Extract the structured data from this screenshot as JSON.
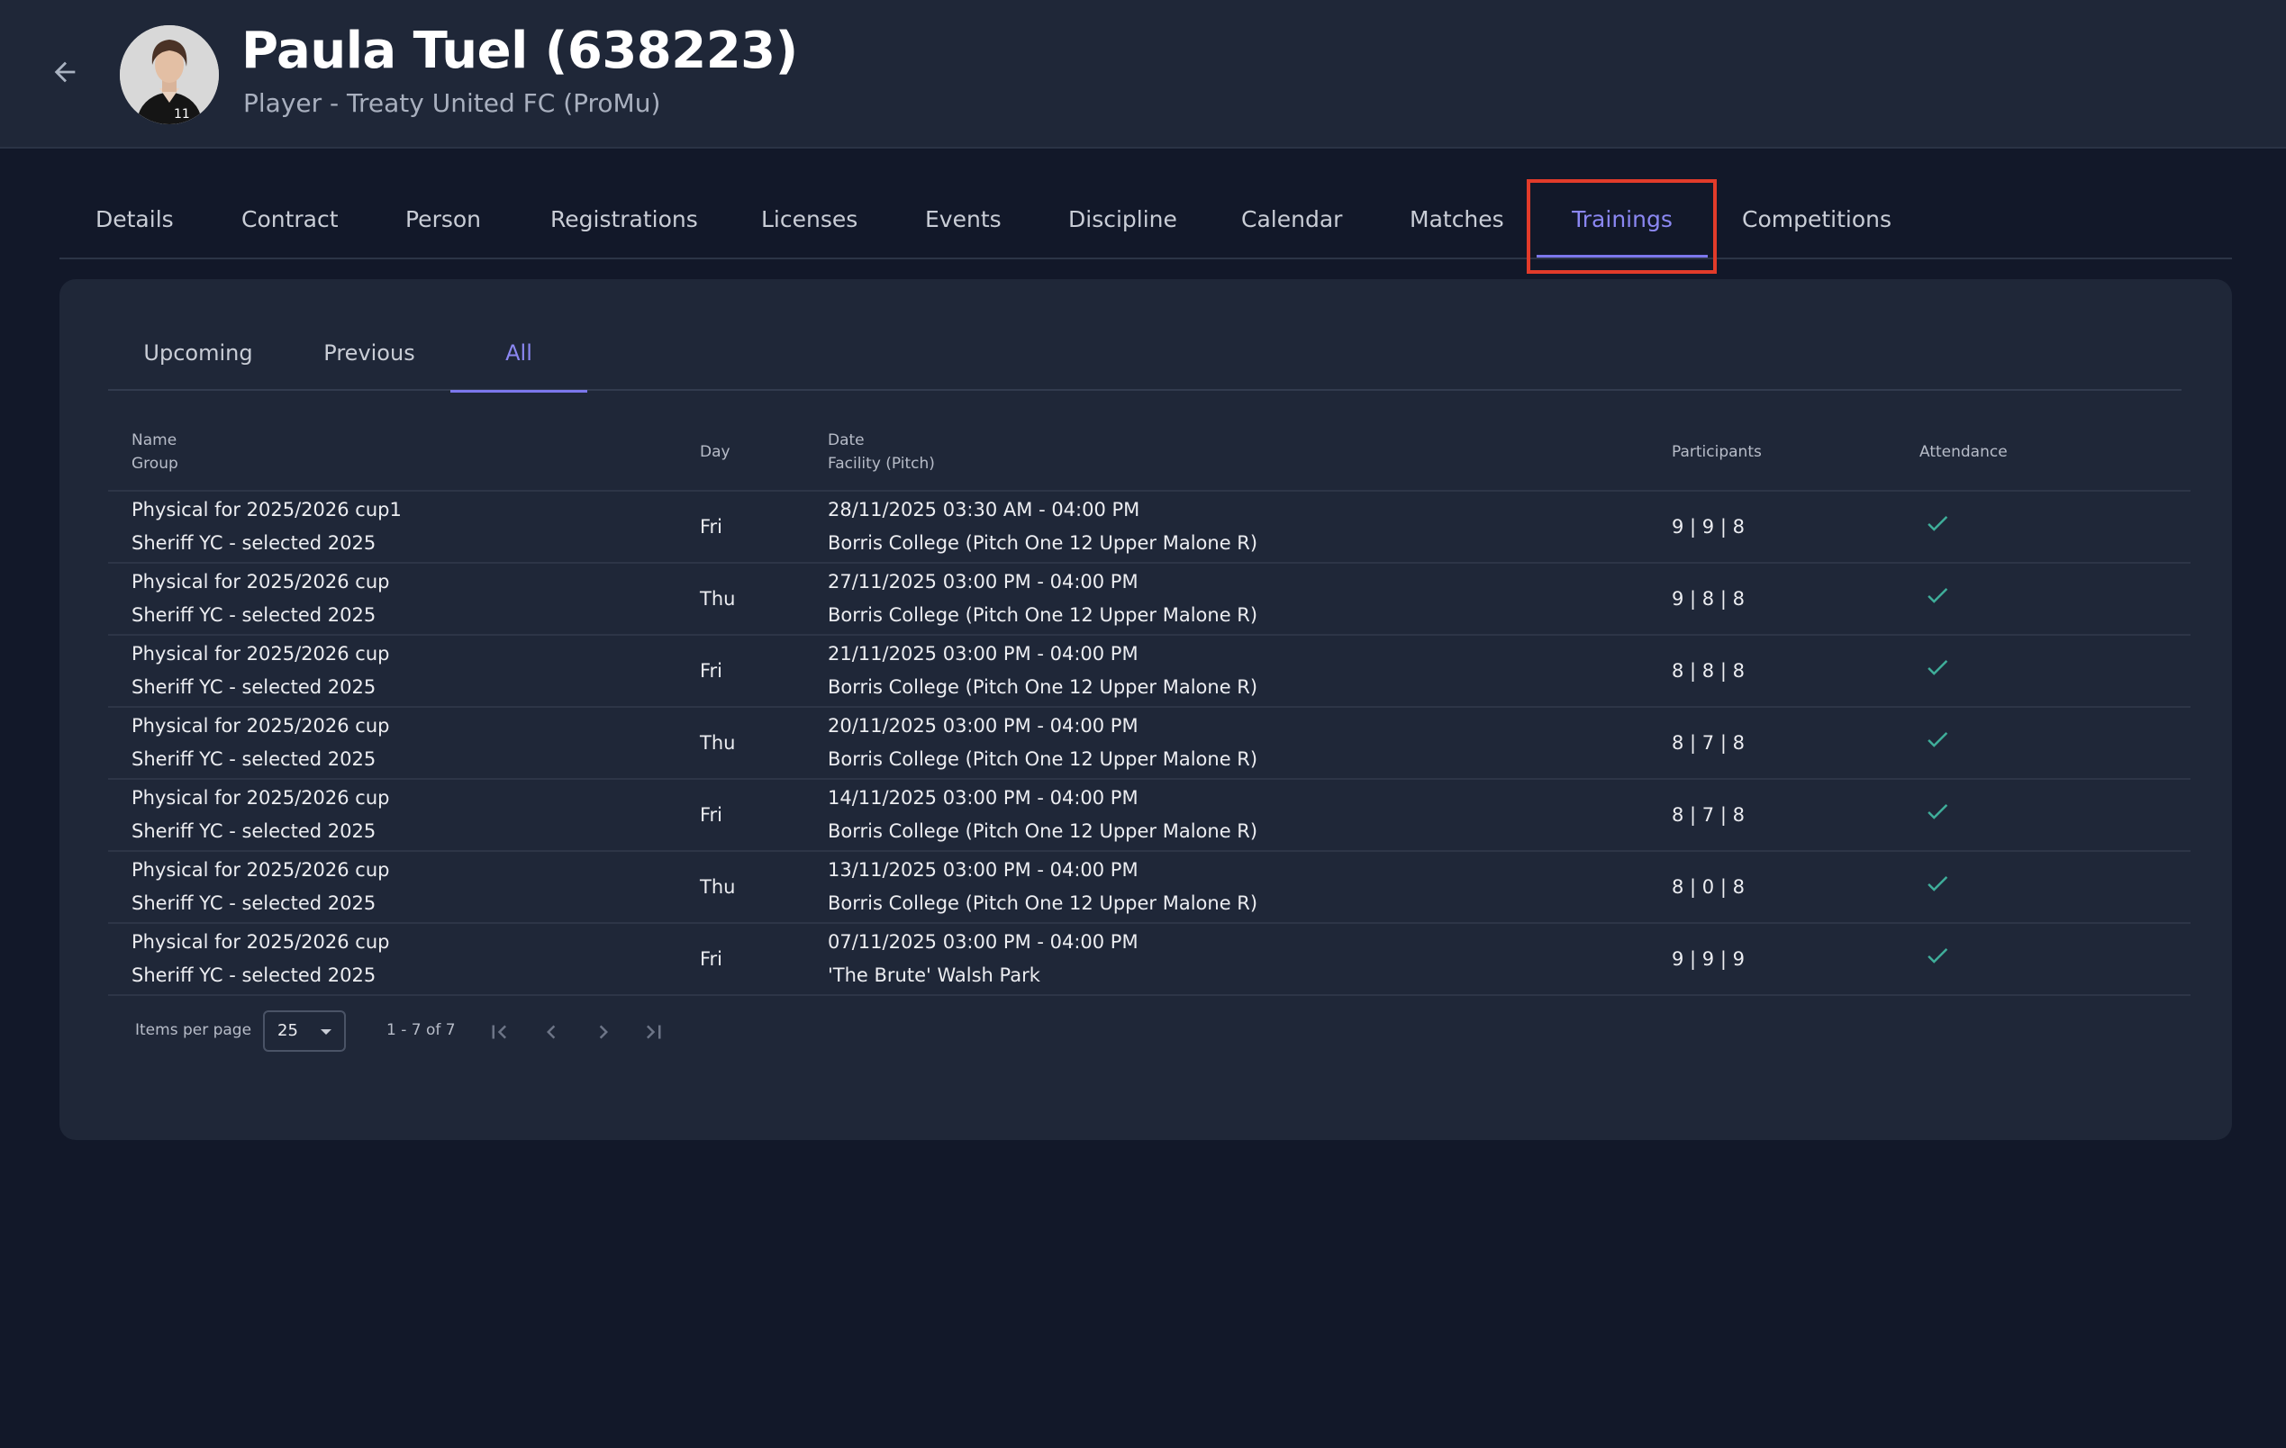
{
  "header": {
    "title": "Paula Tuel (638223)",
    "subtitle": "Player - Treaty United FC (ProMu)",
    "back_icon": "arrow-left-icon",
    "avatar_icon": "player-avatar"
  },
  "main_tabs": [
    {
      "label": "Details"
    },
    {
      "label": "Contract"
    },
    {
      "label": "Person"
    },
    {
      "label": "Registrations"
    },
    {
      "label": "Licenses"
    },
    {
      "label": "Events"
    },
    {
      "label": "Discipline"
    },
    {
      "label": "Calendar"
    },
    {
      "label": "Matches"
    },
    {
      "label": "Trainings",
      "active": true
    },
    {
      "label": "Competitions"
    }
  ],
  "sub_tabs": [
    {
      "label": "Upcoming"
    },
    {
      "label": "Previous"
    },
    {
      "label": "All",
      "active": true
    }
  ],
  "table": {
    "headers": {
      "name": "Name",
      "group": "Group",
      "day": "Day",
      "date": "Date",
      "facility": "Facility (Pitch)",
      "participants": "Participants",
      "attendance": "Attendance"
    },
    "rows": [
      {
        "name": "Physical for 2025/2026 cup1",
        "group": "Sheriff YC - selected 2025",
        "day": "Fri",
        "date": "28/11/2025 03:30 AM - 04:00 PM",
        "facility": "Borris College (Pitch One 12 Upper Malone R)",
        "participants": "9 | 9 | 8",
        "attendance": "check-icon"
      },
      {
        "name": "Physical for 2025/2026 cup",
        "group": "Sheriff YC - selected 2025",
        "day": "Thu",
        "date": "27/11/2025 03:00 PM - 04:00 PM",
        "facility": "Borris College (Pitch One 12 Upper Malone R)",
        "participants": "9 | 8 | 8",
        "attendance": "check-icon"
      },
      {
        "name": "Physical for 2025/2026 cup",
        "group": "Sheriff YC - selected 2025",
        "day": "Fri",
        "date": "21/11/2025 03:00 PM - 04:00 PM",
        "facility": "Borris College (Pitch One 12 Upper Malone R)",
        "participants": "8 | 8 | 8",
        "attendance": "check-icon"
      },
      {
        "name": "Physical for 2025/2026 cup",
        "group": "Sheriff YC - selected 2025",
        "day": "Thu",
        "date": "20/11/2025 03:00 PM - 04:00 PM",
        "facility": "Borris College (Pitch One 12 Upper Malone R)",
        "participants": "8 | 7 | 8",
        "attendance": "check-icon"
      },
      {
        "name": "Physical for 2025/2026 cup",
        "group": "Sheriff YC - selected 2025",
        "day": "Fri",
        "date": "14/11/2025 03:00 PM - 04:00 PM",
        "facility": "Borris College (Pitch One 12 Upper Malone R)",
        "participants": "8 | 7 | 8",
        "attendance": "check-icon"
      },
      {
        "name": "Physical for 2025/2026 cup",
        "group": "Sheriff YC - selected 2025",
        "day": "Thu",
        "date": "13/11/2025 03:00 PM - 04:00 PM",
        "facility": "Borris College (Pitch One 12 Upper Malone R)",
        "participants": "8 | 0 | 8",
        "attendance": "check-icon"
      },
      {
        "name": "Physical for 2025/2026 cup",
        "group": "Sheriff YC - selected 2025",
        "day": "Fri",
        "date": "07/11/2025 03:00 PM - 04:00 PM",
        "facility": "'The Brute' Walsh Park",
        "participants": "9 | 9 | 9",
        "attendance": "check-icon"
      }
    ]
  },
  "pagination": {
    "items_per_page_label": "Items per page",
    "items_per_page_value": "25",
    "range": "1 - 7 of 7"
  },
  "colors": {
    "accent": "#7c77ec",
    "check": "#3fae9a",
    "highlight": "#e23b2a"
  }
}
